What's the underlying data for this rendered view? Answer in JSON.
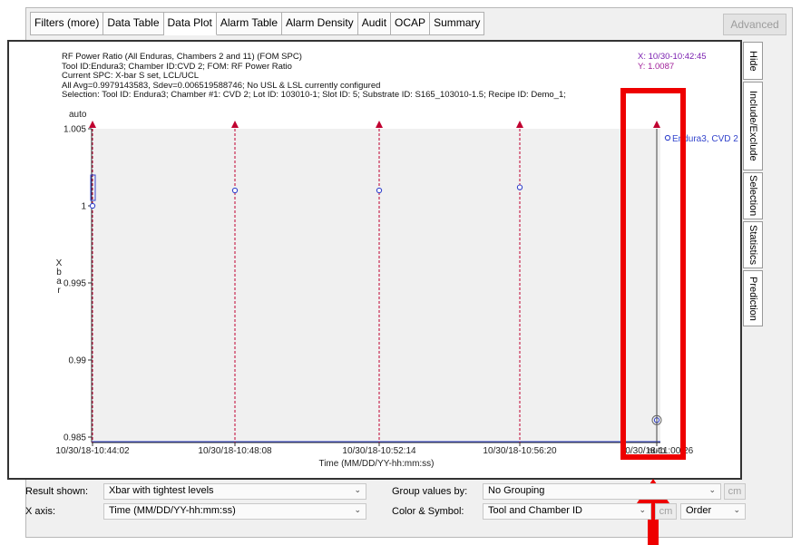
{
  "tabs": [
    "Filters (more)",
    "Data Table",
    "Data Plot",
    "Alarm Table",
    "Alarm Density",
    "Audit",
    "OCAP",
    "Summary"
  ],
  "advanced_label": "Advanced",
  "header": {
    "line1": "RF Power Ratio (All Enduras, Chambers 2 and 11) (FOM SPC)",
    "line2": "Tool ID:Endura3; Chamber ID:CVD 2; FOM: RF Power Ratio",
    "line3": "Current SPC: X-bar S set, LCL/UCL",
    "line4": "All Avg=0.9979143583, Sdev=0.006519588746;    No USL & LSL currently configured",
    "line5": "Selection: Tool ID: Endura3; Chamber #1: CVD 2; Lot ID: 103010-1; Slot ID: 5; Substrate ID: S165_103010-1.5; Recipe ID: Demo_1;"
  },
  "coords": {
    "x": "X: 10/30-10:42:45",
    "y": "Y: 1.0087"
  },
  "colors": {
    "coord_x": "#7a1fb0",
    "coord_y": "#a0209a",
    "accent": "#3344cc",
    "marker": "#c00030",
    "highlight": "#ee0000"
  },
  "chart_data": {
    "type": "scatter",
    "xlabel": "Time (MM/DD/YY-hh:mm:ss)",
    "ylabel": "Xbar",
    "ylim": [
      0.985,
      1.005
    ],
    "y_auto_label": "auto",
    "x_auto_label": "auto",
    "y_ticks": [
      "1.005",
      "1",
      "0.995",
      "0.99",
      "0.985"
    ],
    "x_ticks": [
      "10/30/18-10:44:02",
      "10/30/18-10:48:08",
      "10/30/18-10:52:14",
      "10/30/18-10:56:20",
      "10/30/18-11:00:26"
    ],
    "series": [
      {
        "name": "Endura3, CVD 2",
        "points": [
          {
            "x": "10/30/18-10:44:02",
            "y": 1.0
          },
          {
            "x": "10/30/18-10:48:08",
            "y": 1.001
          },
          {
            "x": "10/30/18-10:52:14",
            "y": 1.001
          },
          {
            "x": "10/30/18-10:56:20",
            "y": 1.0012
          },
          {
            "x": "10/30/18-11:00:26",
            "y": 0.9861
          }
        ]
      }
    ],
    "legend_placement": "top-right"
  },
  "controls": {
    "result_label": "Result shown:",
    "result_value": "Xbar with tightest levels",
    "xaxis_label": "X axis:",
    "xaxis_value": "Time (MM/DD/YY-hh:mm:ss)",
    "group_label": "Group values by:",
    "group_value": "No Grouping",
    "color_label": "Color & Symbol:",
    "color_value": "Tool and Chamber ID",
    "cm_label": "cm",
    "order_value": "Order"
  },
  "side_tabs": [
    "Hide",
    "Include/Exclude",
    "Selection",
    "Statistics",
    "Prediction"
  ]
}
